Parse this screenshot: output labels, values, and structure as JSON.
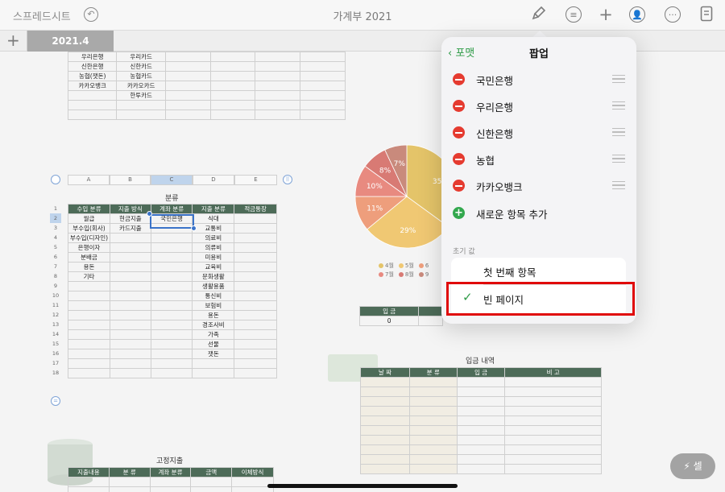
{
  "toolbar": {
    "back_label": "스프레드시트",
    "title": "가계부 2021",
    "icons": [
      "undo-icon",
      "format-brush-icon",
      "sort-icon",
      "add-icon",
      "collaborate-icon",
      "more-icon",
      "document-icon"
    ]
  },
  "tabs": {
    "add_label": "+",
    "active_sheet": "2021.4"
  },
  "top_table": {
    "rows": [
      [
        "우리은행",
        "우리카드"
      ],
      [
        "신한은행",
        "신한카드"
      ],
      [
        "농협(잿돈)",
        "농협카드"
      ],
      [
        "카카오뱅크",
        "카카오카드"
      ],
      [
        "",
        "한투카드"
      ]
    ]
  },
  "category_table": {
    "title": "분류",
    "column_letters": [
      "A",
      "B",
      "C",
      "D",
      "E"
    ],
    "headers": [
      "수입 분류",
      "지출 방식",
      "계좌 분류",
      "지출 분류",
      "적금통장"
    ],
    "row_numbers": [
      "1",
      "2",
      "3",
      "4",
      "5",
      "6",
      "7",
      "8",
      "9",
      "10",
      "11",
      "12",
      "13",
      "14",
      "15",
      "16",
      "17",
      "18"
    ],
    "rows": [
      [
        "월급",
        "현금지출",
        "국민은행",
        "식대",
        ""
      ],
      [
        "부수입(회사)",
        "카드지출",
        "",
        "교통비",
        ""
      ],
      [
        "부수입(디자인)",
        "",
        "",
        "의료비",
        ""
      ],
      [
        "은행이자",
        "",
        "",
        "의류비",
        ""
      ],
      [
        "분배금",
        "",
        "",
        "미용비",
        ""
      ],
      [
        "용돈",
        "",
        "",
        "교육비",
        ""
      ],
      [
        "기타",
        "",
        "",
        "문화생활",
        ""
      ],
      [
        "",
        "",
        "",
        "생활용품",
        ""
      ],
      [
        "",
        "",
        "",
        "통신비",
        ""
      ],
      [
        "",
        "",
        "",
        "보험비",
        ""
      ],
      [
        "",
        "",
        "",
        "용돈",
        ""
      ],
      [
        "",
        "",
        "",
        "경조사비",
        ""
      ],
      [
        "",
        "",
        "",
        "가족",
        ""
      ],
      [
        "",
        "",
        "",
        "선물",
        ""
      ],
      [
        "",
        "",
        "",
        "잿돈",
        ""
      ],
      [
        "",
        "",
        "",
        "",
        ""
      ],
      [
        "",
        "",
        "",
        "",
        ""
      ]
    ]
  },
  "pie_chart": {
    "labels": [
      "35",
      "29%",
      "11%",
      "10%",
      "8%",
      "7%"
    ],
    "colors": {
      "slice_35": "#e4c469",
      "slice_29": "#f0c873",
      "slice_11": "#ee9e7c",
      "slice_10": "#e88a80",
      "slice_8": "#d87a74",
      "slice_7": "#c98a7c"
    },
    "legend": [
      {
        "label": "4월",
        "color": "#e4c469"
      },
      {
        "label": "5월",
        "color": "#f0c873"
      },
      {
        "label": "6",
        "color": "#ee9e7c"
      },
      {
        "label": "7월",
        "color": "#e88a80"
      },
      {
        "label": "8월",
        "color": "#d87a74"
      },
      {
        "label": "9",
        "color": "#c98a7c"
      }
    ]
  },
  "summary_table": {
    "headers": [
      "입 금",
      ""
    ],
    "values": [
      "0",
      ""
    ]
  },
  "income_table": {
    "title": "입금 내역",
    "headers": [
      "날 짜",
      "분 류",
      "입 금",
      "비 고"
    ]
  },
  "fixed_table": {
    "title": "고정지출",
    "headers": [
      "지출내용",
      "분 류",
      "계좌 분류",
      "금액",
      "이체방식"
    ]
  },
  "popover": {
    "back_label": "포맷",
    "title": "팝업",
    "items": [
      "국민은행",
      "우리은행",
      "신한은행",
      "농협",
      "카카오뱅크"
    ],
    "add_label": "새로운 항목 추가",
    "section_label": "초기 값",
    "options": [
      "첫 번째 항목",
      "빈 페이지"
    ],
    "selected_option": "빈 페이지"
  },
  "cell_button": {
    "label": "셀"
  },
  "colors": {
    "header_green": "#4d6b58",
    "accent_green": "#2e9b47",
    "delete_red": "#e53b30",
    "highlight_red": "#e00a0a"
  }
}
